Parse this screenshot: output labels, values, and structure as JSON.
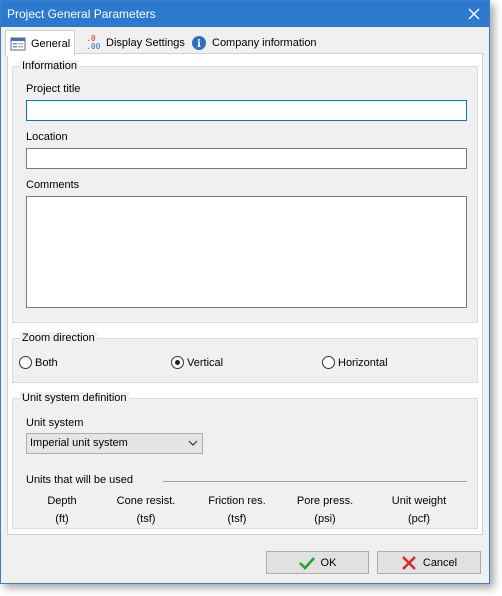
{
  "window": {
    "title": "Project General Parameters"
  },
  "tabs": [
    {
      "label": "General",
      "icon": "form-icon",
      "active": true
    },
    {
      "label": "Display Settings",
      "icon": "decimal-places-icon",
      "active": false
    },
    {
      "label": "Company information",
      "icon": "info-icon",
      "active": false
    }
  ],
  "tab_icon_texts": {
    "decimal_top": ".0",
    "decimal_bottom": ".00",
    "info": "i"
  },
  "information": {
    "group_title": "Information",
    "project_title_label": "Project title",
    "project_title_value": "",
    "location_label": "Location",
    "location_value": "",
    "comments_label": "Comments",
    "comments_value": ""
  },
  "zoom": {
    "group_title": "Zoom direction",
    "options": [
      {
        "label": "Both",
        "selected": false
      },
      {
        "label": "Vertical",
        "selected": true
      },
      {
        "label": "Horizontal",
        "selected": false
      }
    ]
  },
  "units": {
    "group_title": "Unit system definition",
    "unit_system_label": "Unit system",
    "unit_system_value": "Imperial unit system",
    "used_title": "Units that will be used",
    "columns": [
      {
        "name": "Depth",
        "unit": "(ft)"
      },
      {
        "name": "Cone resist.",
        "unit": "(tsf)"
      },
      {
        "name": "Friction res.",
        "unit": "(tsf)"
      },
      {
        "name": "Pore press.",
        "unit": "(psi)"
      },
      {
        "name": "Unit weight",
        "unit": "(pcf)"
      }
    ]
  },
  "buttons": {
    "ok": "OK",
    "cancel": "Cancel"
  },
  "colors": {
    "titlebar": "#2b7ad0",
    "focus_border": "#0078d7",
    "ok_check": "#2aa12a",
    "cancel_x": "#d42a2a",
    "info_icon": "#2f6fbf"
  }
}
